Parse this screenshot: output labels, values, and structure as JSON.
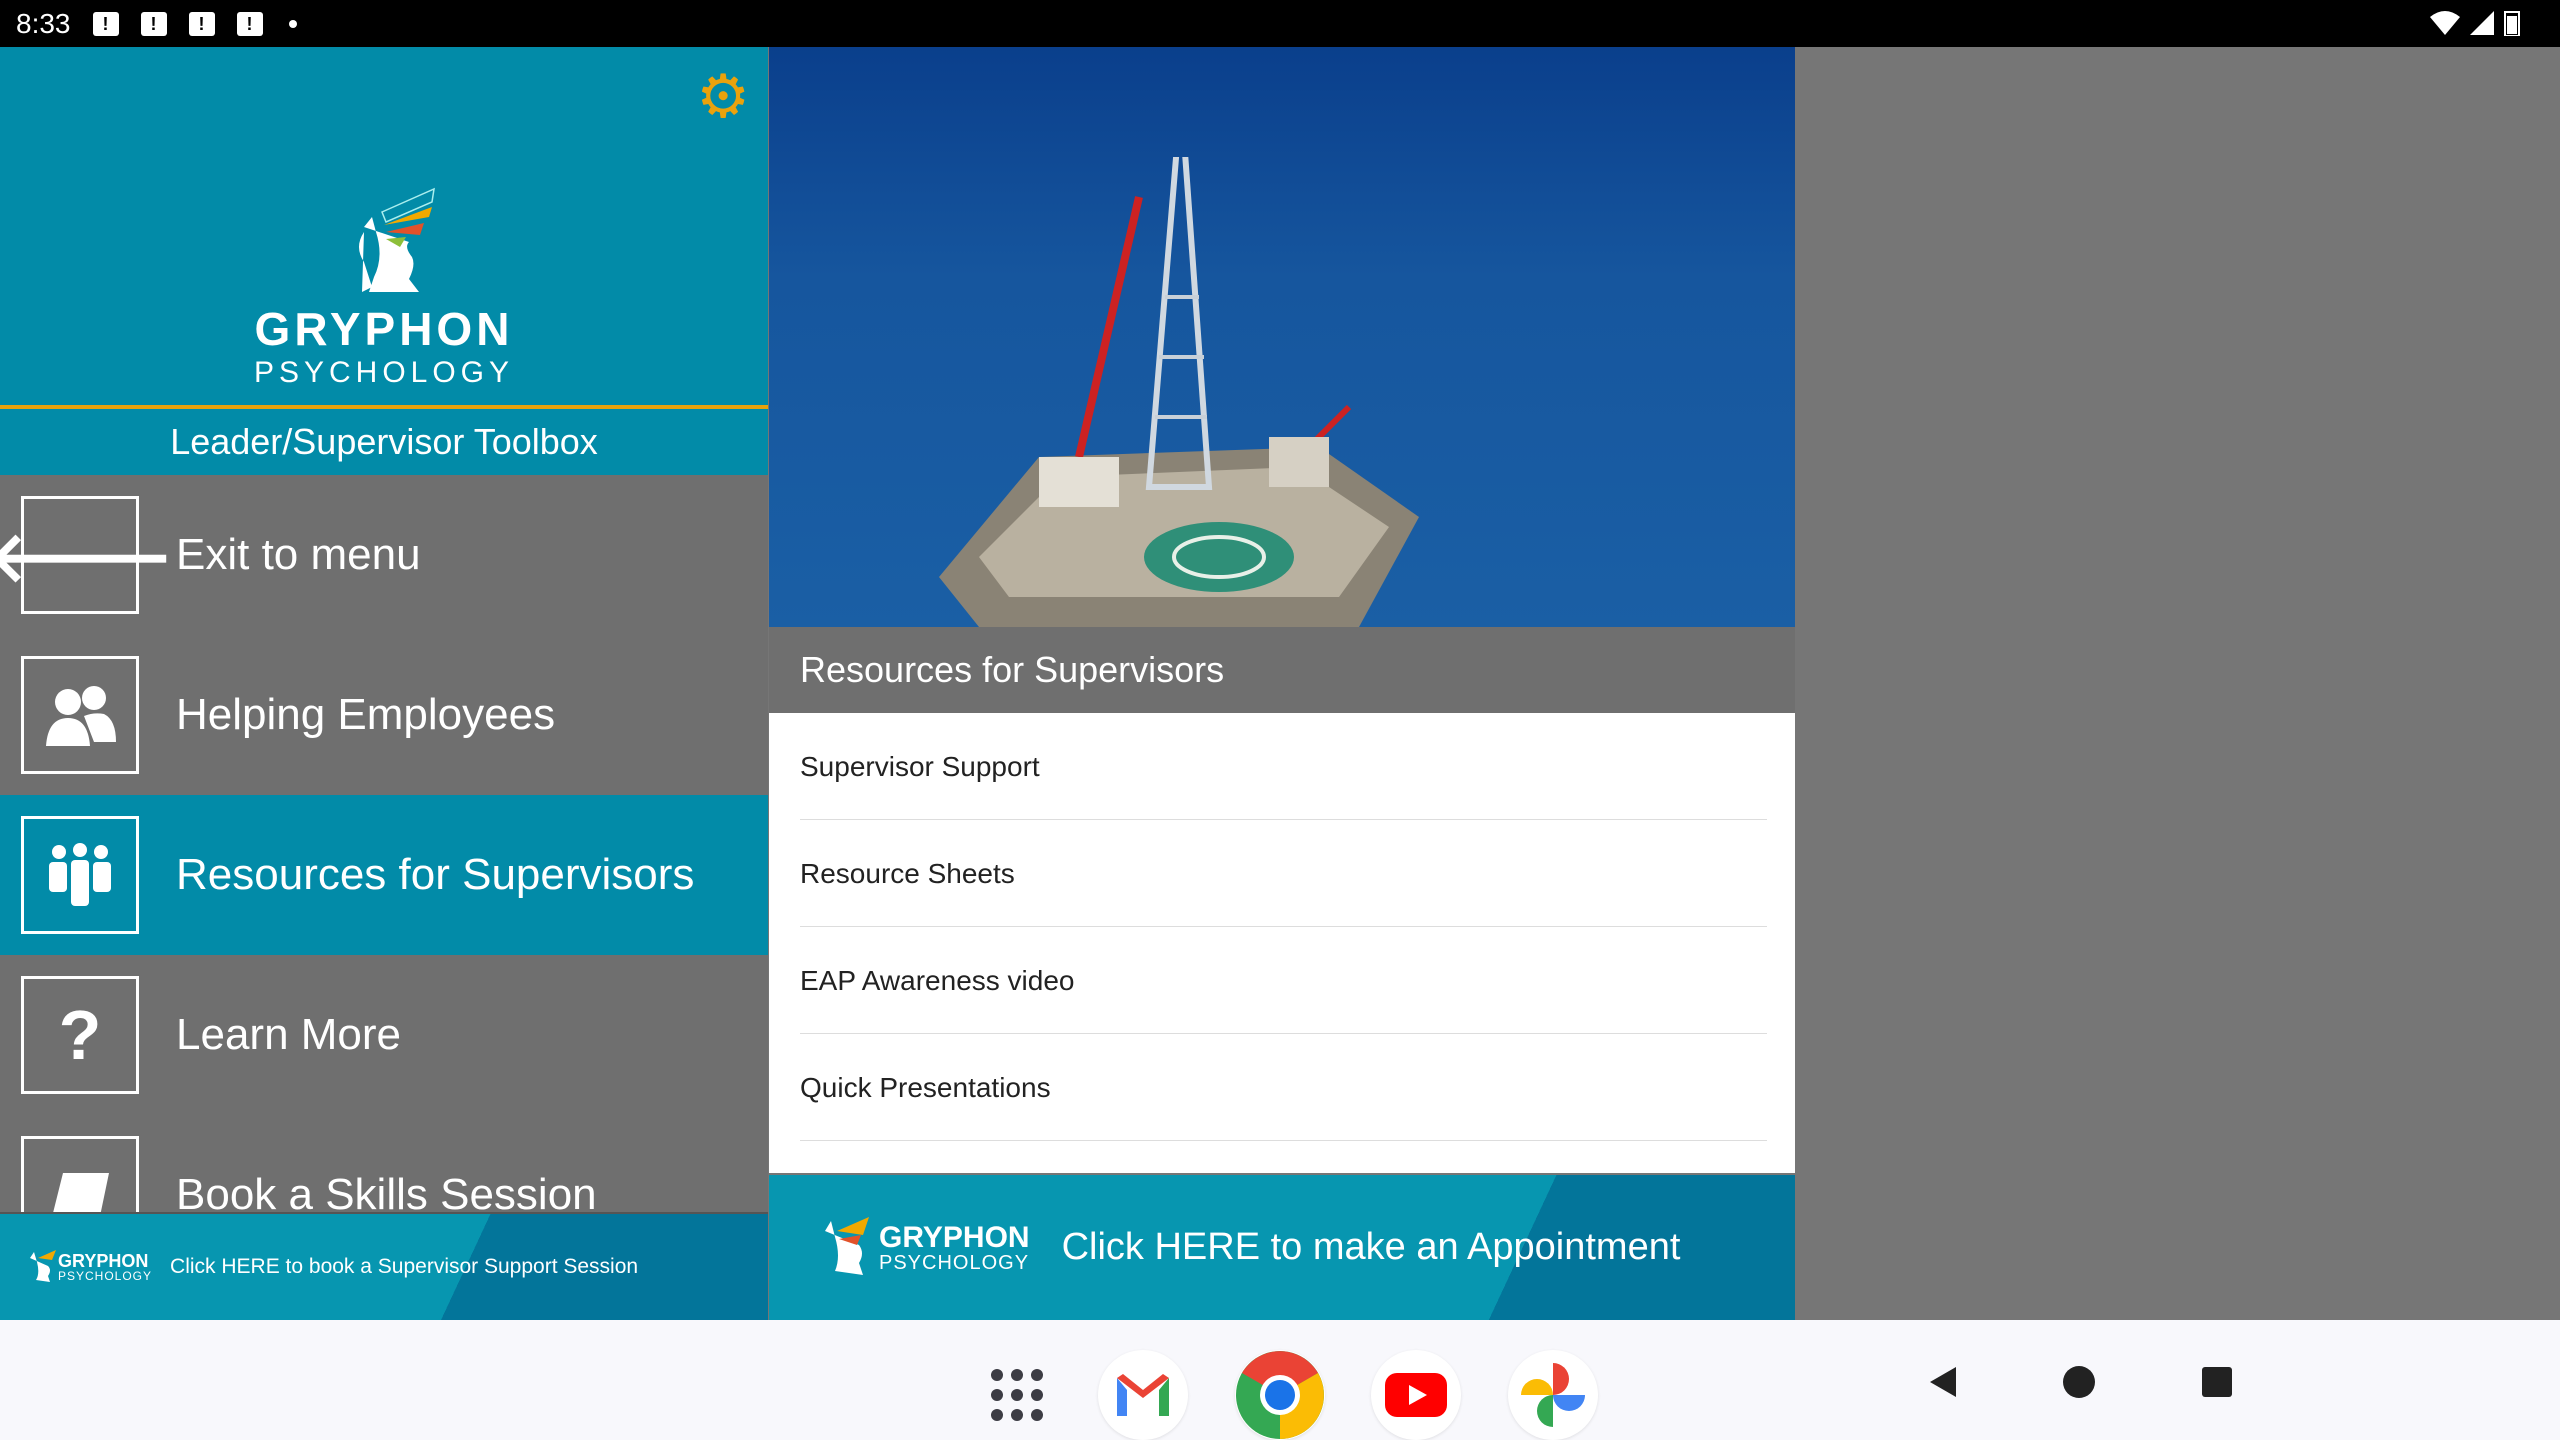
{
  "status_bar": {
    "time": "8:33",
    "notification_count": 4
  },
  "sidebar": {
    "brand": {
      "name": "GRYPHON",
      "sub": "PSYCHOLOGY"
    },
    "toolbox_title": "Leader/Supervisor Toolbox",
    "items": [
      {
        "label": "Exit to menu",
        "icon": "arrow-left-icon"
      },
      {
        "label": "Helping Employees",
        "icon": "people-icon"
      },
      {
        "label": "Resources for Supervisors",
        "icon": "group-icon",
        "active": true
      },
      {
        "label": "Learn More",
        "icon": "question-icon"
      },
      {
        "label": "Book a Skills Session",
        "icon": "book-icon"
      }
    ],
    "banner": {
      "brand": "GRYPHON",
      "sub": "PSYCHOLOGY",
      "text": "Click HERE to book a Supervisor Support Session"
    }
  },
  "main": {
    "section_title": "Resources for Supervisors",
    "list": [
      "Supervisor Support",
      "Resource Sheets",
      "EAP Awareness video",
      "Quick Presentations"
    ],
    "banner": {
      "brand": "GRYPHON",
      "sub": "PSYCHOLOGY",
      "text": "Click HERE to make an Appointment"
    }
  },
  "colors": {
    "teal": "#028ba8",
    "accent": "#e8a20c",
    "gray": "#6f6f6f"
  },
  "taskbar": {
    "apps": [
      "app-drawer",
      "gmail",
      "chrome",
      "youtube",
      "photos"
    ]
  }
}
